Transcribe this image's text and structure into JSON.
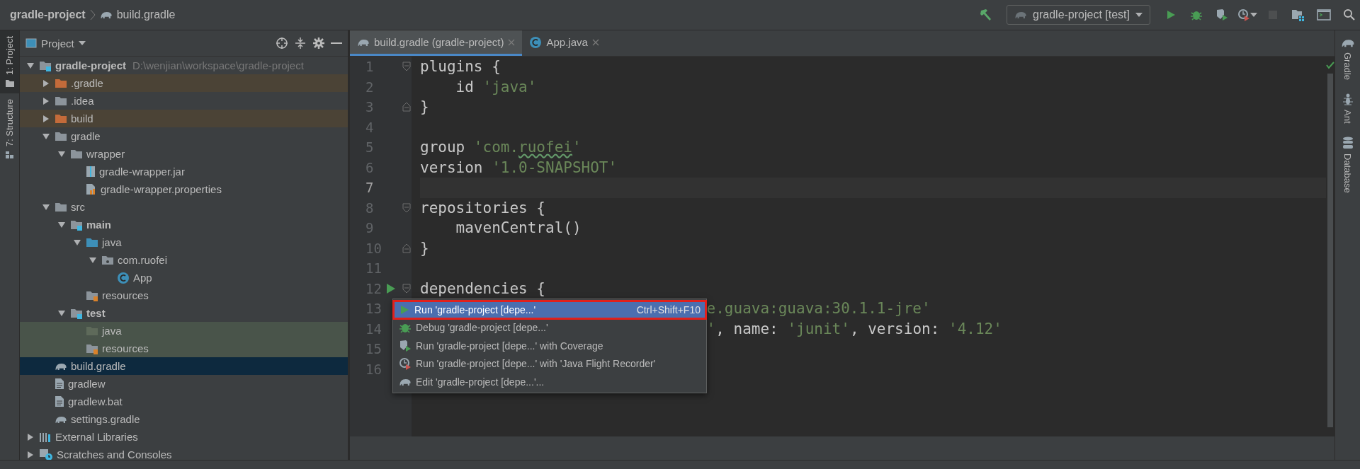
{
  "breadcrumb": [
    {
      "label": "gradle-project",
      "kind": "project"
    },
    {
      "label": "build.gradle",
      "kind": "gradle-file"
    }
  ],
  "toolbar": {
    "run_config": "gradle-project [test]",
    "buttons": [
      {
        "kind": "build",
        "disabled": false
      },
      {
        "kind": "run",
        "disabled": false
      },
      {
        "kind": "debug",
        "disabled": false
      },
      {
        "kind": "coverage",
        "disabled": false
      },
      {
        "kind": "profiler",
        "disabled": false
      },
      {
        "kind": "stop",
        "disabled": true
      },
      {
        "kind": "project-structure",
        "disabled": false
      },
      {
        "kind": "terminal",
        "disabled": false
      },
      {
        "kind": "search",
        "disabled": false
      }
    ]
  },
  "left_strip": [
    {
      "label": "1: Project",
      "kind": "project",
      "selected": true
    },
    {
      "label": "7: Structure",
      "kind": "structure",
      "selected": false
    }
  ],
  "project_panel": {
    "title": "Project",
    "tree": [
      {
        "label": "gradle-project",
        "path": "D:\\wenjian\\workspace\\gradle-project",
        "kind": "module",
        "bold": true,
        "expanded": true,
        "selected": false,
        "children": [
          {
            "label": ".gradle",
            "kind": "excluded-folder",
            "expanded": false,
            "selected": false
          },
          {
            "label": ".idea",
            "kind": "folder",
            "expanded": false,
            "selected": false
          },
          {
            "label": "build",
            "kind": "excluded-folder",
            "expanded": false,
            "selected": false
          },
          {
            "label": "gradle",
            "kind": "folder",
            "expanded": true,
            "selected": false,
            "children": [
              {
                "label": "wrapper",
                "kind": "folder",
                "expanded": true,
                "selected": false,
                "children": [
                  {
                    "label": "gradle-wrapper.jar",
                    "kind": "jar",
                    "selected": false
                  },
                  {
                    "label": "gradle-wrapper.properties",
                    "kind": "properties",
                    "selected": false
                  }
                ]
              }
            ]
          },
          {
            "label": "src",
            "kind": "folder",
            "expanded": true,
            "selected": false,
            "children": [
              {
                "label": "main",
                "kind": "module-folder",
                "bold": true,
                "expanded": true,
                "selected": false,
                "children": [
                  {
                    "label": "java",
                    "kind": "source-folder",
                    "expanded": true,
                    "selected": false,
                    "children": [
                      {
                        "label": "com.ruofei",
                        "kind": "package",
                        "expanded": true,
                        "selected": false,
                        "children": [
                          {
                            "label": "App",
                            "kind": "class",
                            "selected": false
                          }
                        ]
                      }
                    ]
                  },
                  {
                    "label": "resources",
                    "kind": "resources",
                    "selected": false
                  }
                ]
              },
              {
                "label": "test",
                "kind": "module-folder",
                "bold": true,
                "expanded": true,
                "selected": false,
                "children": [
                  {
                    "label": "java",
                    "kind": "test-source",
                    "selected": false
                  },
                  {
                    "label": "resources",
                    "kind": "test-resources",
                    "selected": false
                  }
                ]
              }
            ]
          },
          {
            "label": "build.gradle",
            "kind": "gradle-file",
            "selected": true
          },
          {
            "label": "gradlew",
            "kind": "text-file",
            "selected": false
          },
          {
            "label": "gradlew.bat",
            "kind": "text-file",
            "selected": false
          },
          {
            "label": "settings.gradle",
            "kind": "gradle-file",
            "selected": false
          }
        ]
      },
      {
        "label": "External Libraries",
        "kind": "libraries",
        "expanded": false,
        "selected": false
      },
      {
        "label": "Scratches and Consoles",
        "kind": "scratches",
        "expanded": false,
        "selected": false
      }
    ]
  },
  "editor": {
    "tabs": [
      {
        "label": "build.gradle (gradle-project)",
        "kind": "gradle-file",
        "selected": true
      },
      {
        "label": "App.java",
        "kind": "class",
        "selected": false
      }
    ],
    "lines": [
      {
        "number": "1",
        "current": false,
        "fold_open": true,
        "segments": [
          {
            "text": "plugins {",
            "kind": "plain"
          }
        ]
      },
      {
        "number": "2",
        "current": false,
        "segments": [
          {
            "text": "    id ",
            "kind": "plain"
          },
          {
            "text": "'java'",
            "kind": "string"
          }
        ]
      },
      {
        "number": "3",
        "current": false,
        "fold_close": true,
        "segments": [
          {
            "text": "}",
            "kind": "plain"
          }
        ]
      },
      {
        "number": "4",
        "current": false
      },
      {
        "number": "5",
        "current": false,
        "segments": [
          {
            "text": "group ",
            "kind": "plain"
          },
          {
            "text": "'com.",
            "kind": "string"
          },
          {
            "text": "ruofei",
            "kind": "typo"
          },
          {
            "text": "'",
            "kind": "string"
          }
        ]
      },
      {
        "number": "6",
        "current": false,
        "segments": [
          {
            "text": "version ",
            "kind": "plain"
          },
          {
            "text": "'1.0-SNAPSHOT'",
            "kind": "string"
          }
        ]
      },
      {
        "number": "7",
        "current": true
      },
      {
        "number": "8",
        "current": false,
        "fold_open": true,
        "segments": [
          {
            "text": "repositories {",
            "kind": "plain"
          }
        ]
      },
      {
        "number": "9",
        "current": false,
        "segments": [
          {
            "text": "    mavenCentral()",
            "kind": "plain"
          }
        ]
      },
      {
        "number": "10",
        "current": false,
        "fold_close": true,
        "segments": [
          {
            "text": "}",
            "kind": "plain"
          }
        ]
      },
      {
        "number": "11",
        "current": false
      },
      {
        "number": "12",
        "current": false,
        "fold_open": true,
        "run_marker": true,
        "segments": [
          {
            "text": "dependencies {",
            "kind": "plain"
          }
        ]
      },
      {
        "number": "13",
        "current": false,
        "covered": true,
        "segments": [
          {
            "text": "e.guava:guava:30.1.1-jre'",
            "kind": "string"
          }
        ]
      },
      {
        "number": "14",
        "current": false,
        "covered": true,
        "segments": [
          {
            "text": "'",
            "kind": "string"
          },
          {
            "text": ", name: ",
            "kind": "plain"
          },
          {
            "text": "'junit'",
            "kind": "string"
          },
          {
            "text": ", version: ",
            "kind": "plain"
          },
          {
            "text": "'4.12'",
            "kind": "string"
          }
        ]
      },
      {
        "number": "15",
        "current": false
      },
      {
        "number": "16",
        "current": false
      }
    ],
    "popup": {
      "items": [
        {
          "label": "Run 'gradle-project [depe...'",
          "kind": "run",
          "shortcut": "Ctrl+Shift+F10",
          "selected": true
        },
        {
          "label": "Debug 'gradle-project [depe...'",
          "kind": "debug",
          "selected": false
        },
        {
          "label": "Run 'gradle-project [depe...' with Coverage",
          "kind": "coverage",
          "selected": false
        },
        {
          "label": "Run 'gradle-project [depe...' with 'Java Flight Recorder'",
          "kind": "profiler",
          "selected": false
        },
        {
          "label": "Edit 'gradle-project [depe...'...",
          "kind": "edit",
          "selected": false
        }
      ]
    }
  },
  "right_strip": [
    {
      "label": "Gradle",
      "kind": "gradle"
    },
    {
      "label": "Ant",
      "kind": "ant"
    },
    {
      "label": "Database",
      "kind": "database"
    }
  ]
}
